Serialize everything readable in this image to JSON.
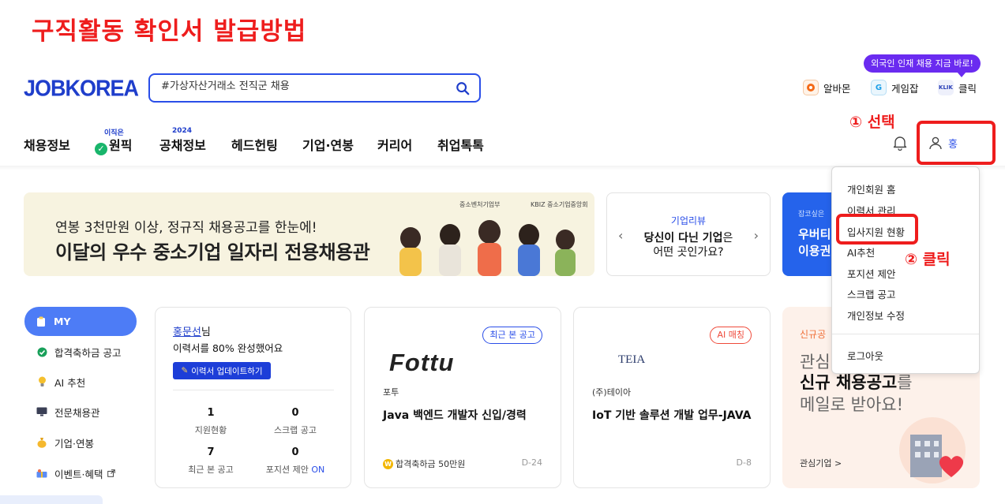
{
  "guide": {
    "title": "구직활동 확인서 발급방법",
    "select_label": "① 선택",
    "click_label": "② 클릭"
  },
  "header": {
    "logo": "JOBKOREA",
    "search_placeholder": "#가상자산거래소 전직군 채용",
    "foreign_badge": "외국인 인재 채용 지금 바로!",
    "family_sites": [
      {
        "label": "알바몬",
        "icon": "albamon-icon",
        "color": "#f46a17"
      },
      {
        "label": "게임잡",
        "icon": "gamejob-icon",
        "color": "#1a9ee8"
      },
      {
        "label": "클릭",
        "icon": "klik-icon",
        "icon_text": "KLIK",
        "color": "#2a3fb8"
      }
    ],
    "user_name": "홍",
    "nav": [
      {
        "label": "채용정보",
        "sup": ""
      },
      {
        "label": "원픽",
        "sup": "이직은"
      },
      {
        "label": "공채정보",
        "sup": "2024"
      },
      {
        "label": "헤드헌팅",
        "sup": ""
      },
      {
        "label": "기업·연봉",
        "sup": ""
      },
      {
        "label": "커리어",
        "sup": ""
      },
      {
        "label": "취업톡톡",
        "sup": ""
      }
    ]
  },
  "banners": {
    "main": {
      "line1": "연봉 3천만원 이상, 정규직 채용공고를 한눈에!",
      "line2": "이달의 우수 중소기업 일자리 전용채용관",
      "org1": "중소벤처기업부",
      "org2": "KBIZ 중소기업중앙회"
    },
    "review": {
      "tag": "기업리뷰",
      "line1_bold": "당신이 다닌 기업",
      "line1_rest": "은",
      "line2": "어떤 곳인가요?"
    },
    "side": {
      "small": "잡코싶은",
      "line1": "우버티",
      "line2": "이용권"
    }
  },
  "sidebar": {
    "my": "MY",
    "items": [
      {
        "label": "합격축하금 공고",
        "icon": "check-circle-icon"
      },
      {
        "label": "AI 추천",
        "icon": "lightbulb-icon"
      },
      {
        "label": "전문채용관",
        "icon": "monitor-icon"
      },
      {
        "label": "기업·연봉",
        "icon": "money-bag-icon"
      },
      {
        "label": "이벤트·혜택",
        "icon": "gift-icon"
      }
    ]
  },
  "profile": {
    "name": "홍문선",
    "suffix": "님",
    "completion": "이력서를 80% 완성했어요",
    "update_button": "이력서 업데이트하기",
    "stats": [
      {
        "value": "1",
        "label": "지원현황"
      },
      {
        "value": "0",
        "label": "스크랩 공고"
      },
      {
        "value": "7",
        "label": "최근 본 공고"
      },
      {
        "value": "0",
        "label": "포지션 제안",
        "extra": "ON"
      }
    ]
  },
  "jobs": [
    {
      "chip": "최근 본 공고",
      "chip_color": "#2a4ee8",
      "logo": "Fottu",
      "company": "포투",
      "title": "Java 백엔드 개발자 신입/경력",
      "reward": "합격축하금 50만원",
      "dday": "D-24"
    },
    {
      "chip": "AI 매칭",
      "chip_color": "#ef4a3a",
      "logo": "TEIA",
      "company": "(주)테이아",
      "title": "IoT 기반 솔루션 개발 업무-JAVA",
      "reward": "",
      "dday": "D-8"
    }
  ],
  "alert_card": {
    "tag": "신규공",
    "line1": "관심",
    "line2_bold": "신규 채용공고",
    "line2_rest": "를",
    "line3": "메일로 받아요!",
    "link": "관심기업 >"
  },
  "dropdown": {
    "items": [
      "개인회원 홈",
      "이력서 관리",
      "입사지원 현황",
      "AI추천",
      "포지션 제안",
      "스크랩 공고",
      "개인정보 수정"
    ],
    "logout": "로그아웃"
  }
}
